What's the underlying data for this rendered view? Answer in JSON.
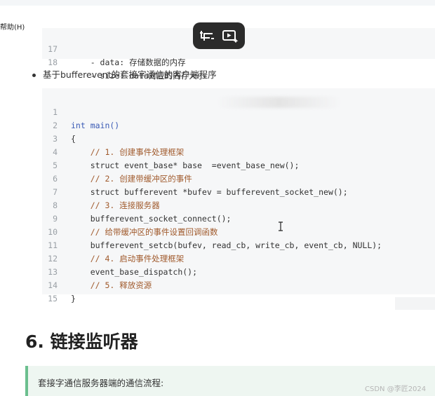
{
  "menu": {
    "help": "帮助(H)"
  },
  "code_top": {
    "lines": [
      {
        "num": "17",
        "text": "    - data: 存储数据的内存"
      },
      {
        "num": "18",
        "text": "    - size: data对应的内存大小"
      }
    ]
  },
  "bullet": {
    "text": "基于bufferevent的套接字通信的客户端程序"
  },
  "code_bottom": {
    "lines": [
      {
        "num": "1",
        "text": "int main()"
      },
      {
        "num": "2",
        "text": "{"
      },
      {
        "num": "3",
        "text": "    // 1. 创建事件处理框架"
      },
      {
        "num": "4",
        "text": "    struct event_base* base  =event_base_new();"
      },
      {
        "num": "5",
        "text": "    // 2. 创建带缓冲区的事件"
      },
      {
        "num": "6",
        "text": "    struct bufferevent *bufev = bufferevent_socket_new();"
      },
      {
        "num": "7",
        "text": "    // 3. 连接服务器"
      },
      {
        "num": "8",
        "text": "    bufferevent_socket_connect();"
      },
      {
        "num": "9",
        "text": "    // 给带缓冲区的事件设置回调函数"
      },
      {
        "num": "10",
        "text": "    bufferevent_setcb(bufev, read_cb, write_cb, event_cb, NULL);"
      },
      {
        "num": "11",
        "text": "    // 4. 启动事件处理框架"
      },
      {
        "num": "12",
        "text": "    event_base_dispatch();"
      },
      {
        "num": "13",
        "text": "    // 5. 释放资源"
      },
      {
        "num": "14",
        "text": "}"
      },
      {
        "num": "15",
        "text": ""
      }
    ]
  },
  "overlay": {
    "icons": [
      "screenshot-crop-icon",
      "video-ai-icon"
    ]
  },
  "heading": {
    "text": "6. 链接监听器"
  },
  "note": {
    "text": "套接字通信服务器端的通信流程:"
  },
  "watermark": {
    "text": "CSDN @李匠2024"
  }
}
